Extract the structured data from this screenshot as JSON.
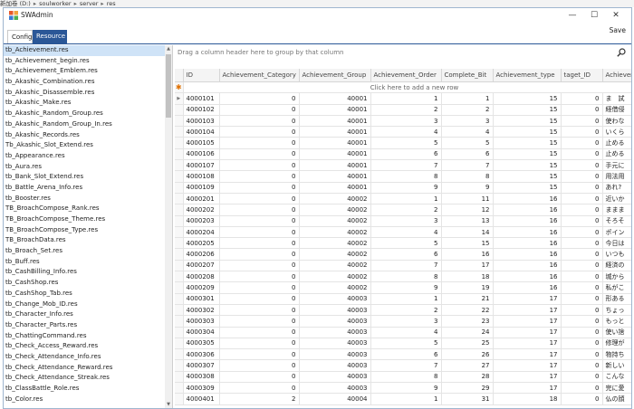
{
  "path": {
    "items": [
      "新加卷 (D:)",
      "soulworker",
      "server",
      "res"
    ],
    "separator": "▸"
  },
  "window": {
    "title": "SWAdmin",
    "save_label": "Save",
    "minimize_glyph": "—",
    "maximize_glyph": "☐",
    "close_glyph": "✕"
  },
  "tabs": [
    {
      "label": "Config",
      "active": false
    },
    {
      "label": "Resource",
      "active": true
    }
  ],
  "resources": [
    "tb_Achievement.res",
    "tb_Achievement_begin.res",
    "tb_Achievement_Emblem.res",
    "tb_Akashic_Combination.res",
    "tb_Akashic_Disassemble.res",
    "tb_Akashic_Make.res",
    "tb_Akashic_Random_Group.res",
    "tb_Akashic_Random_Group_In.res",
    "tb_Akashic_Records.res",
    "Tb_Akashic_Slot_Extend.res",
    "tb_Appearance.res",
    "tb_Aura.res",
    "tb_Bank_Slot_Extend.res",
    "tb_Battle_Arena_Info.res",
    "tb_Booster.res",
    "TB_BroachCompose_Rank.res",
    "TB_BroachCompose_Theme.res",
    "TB_BroachCompose_Type.res",
    "TB_BroachData.res",
    "tb_Broach_Set.res",
    "tb_Buff.res",
    "tb_CashBilling_Info.res",
    "tb_CashShop.res",
    "tb_CashShop_Tab.res",
    "tb_Change_Mob_ID.res",
    "tb_Character_Info.res",
    "tb_Character_Parts.res",
    "tb_ChattingCommand.res",
    "tb_Check_Access_Reward.res",
    "tb_Check_Attendance_Info.res",
    "tb_Check_Attendance_Reward.res",
    "tb_Check_Attendance_Streak.res",
    "tb_ClassBattle_Role.res",
    "tb_Color.res"
  ],
  "selected_resource_index": 0,
  "grid": {
    "group_hint": "Drag a column header here to group by that column",
    "new_row_hint": "Click here to add a new row",
    "columns": [
      "ID",
      "Achievement_Category",
      "Achievement_Group",
      "Achievement_Order",
      "Complete_Bit",
      "Achievement_type",
      "taget_ID",
      "Achieveme"
    ],
    "rows": [
      [
        "4000101",
        "0",
        "40001",
        "1",
        "1",
        "15",
        "0",
        "ま　試"
      ],
      [
        "4000102",
        "0",
        "40001",
        "2",
        "2",
        "15",
        "0",
        "経借侵"
      ],
      [
        "4000103",
        "0",
        "40001",
        "3",
        "3",
        "15",
        "0",
        "使わな"
      ],
      [
        "4000104",
        "0",
        "40001",
        "4",
        "4",
        "15",
        "0",
        "いくら"
      ],
      [
        "4000105",
        "0",
        "40001",
        "5",
        "5",
        "15",
        "0",
        "止める"
      ],
      [
        "4000106",
        "0",
        "40001",
        "6",
        "6",
        "15",
        "0",
        "止める"
      ],
      [
        "4000107",
        "0",
        "40001",
        "7",
        "7",
        "15",
        "0",
        "手元に"
      ],
      [
        "4000108",
        "0",
        "40001",
        "8",
        "8",
        "15",
        "0",
        "用法用"
      ],
      [
        "4000109",
        "0",
        "40001",
        "9",
        "9",
        "15",
        "0",
        "あれ?"
      ],
      [
        "4000201",
        "0",
        "40002",
        "1",
        "11",
        "16",
        "0",
        "近いか"
      ],
      [
        "4000202",
        "0",
        "40002",
        "2",
        "12",
        "16",
        "0",
        "ままま"
      ],
      [
        "4000203",
        "0",
        "40002",
        "3",
        "13",
        "16",
        "0",
        "そろそ"
      ],
      [
        "4000204",
        "0",
        "40002",
        "4",
        "14",
        "16",
        "0",
        "ポイン"
      ],
      [
        "4000205",
        "0",
        "40002",
        "5",
        "15",
        "16",
        "0",
        "今日は"
      ],
      [
        "4000206",
        "0",
        "40002",
        "6",
        "16",
        "16",
        "0",
        "いつも"
      ],
      [
        "4000207",
        "0",
        "40002",
        "7",
        "17",
        "16",
        "0",
        "経済の"
      ],
      [
        "4000208",
        "0",
        "40002",
        "8",
        "18",
        "16",
        "0",
        "城から"
      ],
      [
        "4000209",
        "0",
        "40002",
        "9",
        "19",
        "16",
        "0",
        "私がこ"
      ],
      [
        "4000301",
        "0",
        "40003",
        "1",
        "21",
        "17",
        "0",
        "形ある"
      ],
      [
        "4000302",
        "0",
        "40003",
        "2",
        "22",
        "17",
        "0",
        "ちょっ"
      ],
      [
        "4000303",
        "0",
        "40003",
        "3",
        "23",
        "17",
        "0",
        "もっと"
      ],
      [
        "4000304",
        "0",
        "40003",
        "4",
        "24",
        "17",
        "0",
        "使い捨"
      ],
      [
        "4000305",
        "0",
        "40003",
        "5",
        "25",
        "17",
        "0",
        "修理が"
      ],
      [
        "4000306",
        "0",
        "40003",
        "6",
        "26",
        "17",
        "0",
        "物持ち"
      ],
      [
        "4000307",
        "0",
        "40003",
        "7",
        "27",
        "17",
        "0",
        "新しい"
      ],
      [
        "4000308",
        "0",
        "40003",
        "8",
        "28",
        "17",
        "0",
        "こんな"
      ],
      [
        "4000309",
        "0",
        "40003",
        "9",
        "29",
        "17",
        "0",
        "完に愛"
      ],
      [
        "4000401",
        "2",
        "40004",
        "1",
        "31",
        "18",
        "0",
        "仏の顔"
      ]
    ]
  },
  "colors": {
    "accent": "#2b5797",
    "selection": "#cfe3f7",
    "new_row_star": "#e07000"
  },
  "icons": {
    "app": "app-logo-icon",
    "search": "search-icon",
    "row_pointer": "row-pointer-icon"
  }
}
